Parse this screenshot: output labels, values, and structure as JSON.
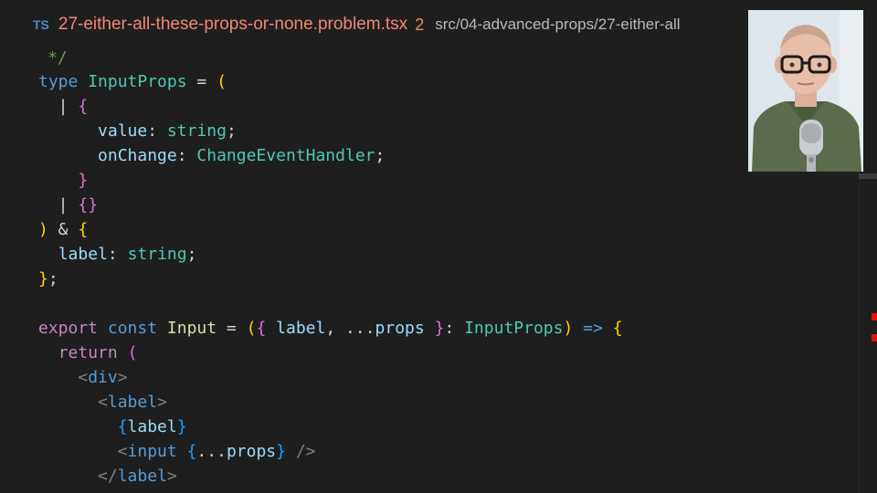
{
  "tab": {
    "language_badge": "TS",
    "filename": "27-either-all-these-props-or-none.problem.tsx",
    "problem_count": "2",
    "path": "src/04-advanced-props/27-either-all"
  },
  "code": {
    "l01": [
      "*/"
    ],
    "l02": [
      "type",
      " ",
      "InputProps",
      " = ",
      "("
    ],
    "l03": [
      "  | ",
      "{"
    ],
    "l04": [
      "      ",
      "value",
      ": ",
      "string",
      ";"
    ],
    "l05": [
      "      ",
      "onChange",
      ": ",
      "ChangeEventHandler",
      ";"
    ],
    "l06": [
      "    ",
      "}"
    ],
    "l07": [
      "  | ",
      "{}"
    ],
    "l08": [
      ")",
      " & ",
      "{"
    ],
    "l09": [
      "  ",
      "label",
      ": ",
      "string",
      ";"
    ],
    "l10": [
      "}",
      ";"
    ],
    "l11": [
      "export",
      " ",
      "const",
      " ",
      "Input",
      " = ",
      "(",
      "{",
      " ",
      "label",
      ", ",
      "...",
      "props",
      " ",
      "}",
      ": ",
      "InputProps",
      ")",
      " ",
      "=>",
      " ",
      "{"
    ],
    "l12": [
      "  ",
      "return",
      " ",
      "("
    ],
    "l13": [
      "    ",
      "<",
      "div",
      ">"
    ],
    "l14": [
      "      ",
      "<",
      "label",
      ">"
    ],
    "l15": [
      "        ",
      "{",
      "label",
      "}"
    ],
    "l16": [
      "        ",
      "<",
      "input",
      " ",
      "{",
      "...",
      "props",
      "}",
      " ",
      "/>"
    ],
    "l17": [
      "      ",
      "</",
      "label",
      ">"
    ]
  },
  "webcam": {
    "subject": "presenter-webcam"
  },
  "scrollbar": {
    "error_markers": 2
  }
}
